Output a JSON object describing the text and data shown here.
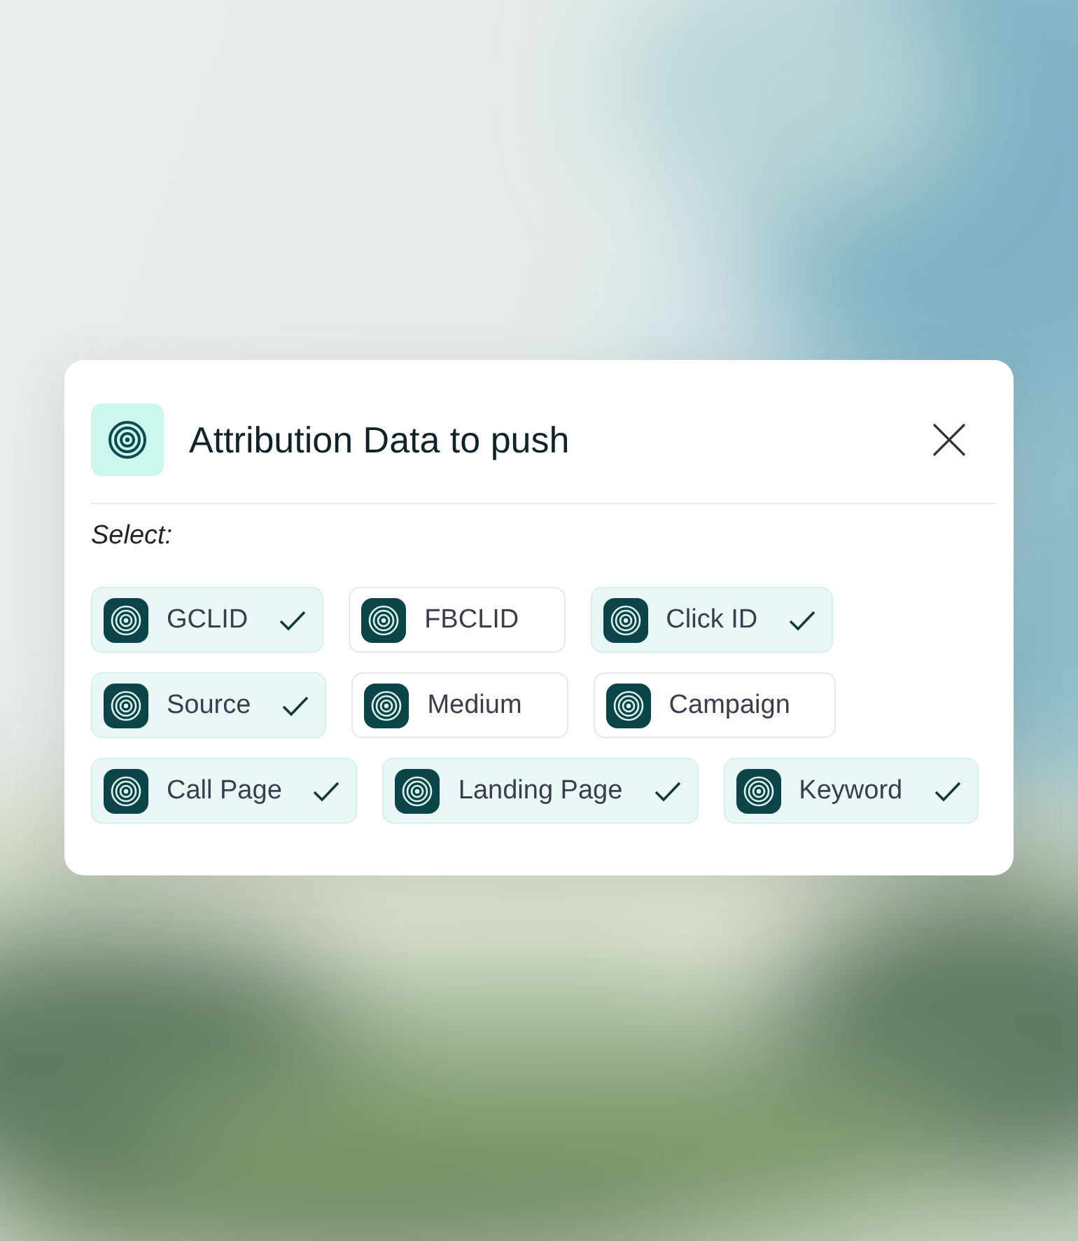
{
  "dialog": {
    "title": "Attribution Data to push",
    "prompt": "Select:",
    "rows": [
      [
        {
          "label": "GCLID",
          "selected": true
        },
        {
          "label": "FBCLID",
          "selected": false
        },
        {
          "label": "Click ID",
          "selected": true
        }
      ],
      [
        {
          "label": "Source",
          "selected": true
        },
        {
          "label": "Medium",
          "selected": false
        },
        {
          "label": "Campaign",
          "selected": false
        }
      ],
      [
        {
          "label": "Call Page",
          "selected": true
        },
        {
          "label": "Landing Page",
          "selected": true
        },
        {
          "label": "Keyword",
          "selected": true
        }
      ]
    ]
  }
}
